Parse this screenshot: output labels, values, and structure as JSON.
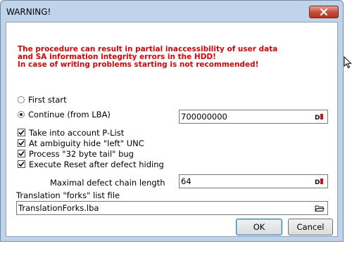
{
  "window": {
    "title": "WARNING!"
  },
  "warning_lines": [
    "The procedure can result in partial inaccessibility of user data",
    "and SA information integrity errors in the HDD!",
    "In case of writing problems starting is not recommended!"
  ],
  "start_mode": {
    "first_start_label": "First start",
    "continue_label": "Continue (from LBA)",
    "selected": "continue",
    "lba_value": "700000000"
  },
  "options": [
    {
      "label": "Take into account P-List",
      "checked": true
    },
    {
      "label": "At ambiguity hide \"left\" UNC",
      "checked": true
    },
    {
      "label": "Process \"32 byte tail\" bug",
      "checked": true
    },
    {
      "label": "Execute Reset after defect hiding",
      "checked": true
    }
  ],
  "defect_chain": {
    "label": "Maximal defect chain length",
    "value": "64"
  },
  "forks_file": {
    "label": "Translation \"forks\" list file",
    "value": "TranslationForks.lba"
  },
  "buttons": {
    "ok": "OK",
    "cancel": "Cancel"
  },
  "colors": {
    "warning_text": "#e00000",
    "close_button": "#c74b34",
    "title_bar": "#bfd3ea"
  },
  "icons": {
    "close": "close-x-icon",
    "spin_edit": "spin-edit-icon",
    "folder": "open-folder-icon",
    "cursor": "mouse-pointer-icon"
  }
}
